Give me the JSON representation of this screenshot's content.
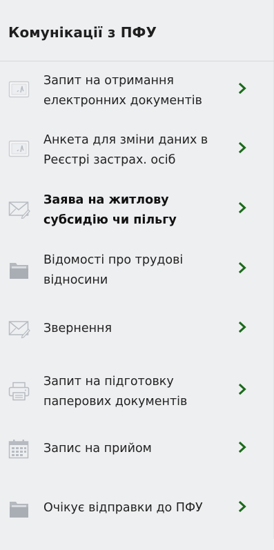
{
  "panel": {
    "title": "Комунікації з ПФУ"
  },
  "menu": {
    "items": [
      {
        "id": "request-electronic-docs",
        "label": "Запит на отримання електронних документів",
        "icon": "document-signature-icon",
        "bold": false
      },
      {
        "id": "form-change-data",
        "label": "Анкета для зміни даних в Реєстрі застрах. осіб",
        "icon": "document-signature-icon",
        "bold": false
      },
      {
        "id": "housing-subsidy",
        "label": "Заява на житлову субсидію чи пільгу",
        "icon": "envelope-pen-icon",
        "bold": true
      },
      {
        "id": "employment-info",
        "label": "Відомості про трудові відносини",
        "icon": "folder-icon",
        "bold": false
      },
      {
        "id": "appeal",
        "label": "Звернення",
        "icon": "envelope-pen-icon",
        "bold": false
      },
      {
        "id": "paper-docs",
        "label": "Запит на підготовку паперових документів",
        "icon": "printer-icon",
        "bold": false
      },
      {
        "id": "appointment",
        "label": "Запис на прийом",
        "icon": "calendar-icon",
        "bold": false
      },
      {
        "id": "pending-send",
        "label": "Очікує відправки до ПФУ",
        "icon": "folder-icon",
        "bold": false
      }
    ]
  },
  "colors": {
    "background": "#eeeff1",
    "chevron": "#1b6a1b",
    "icon": "#bfc3c9"
  }
}
